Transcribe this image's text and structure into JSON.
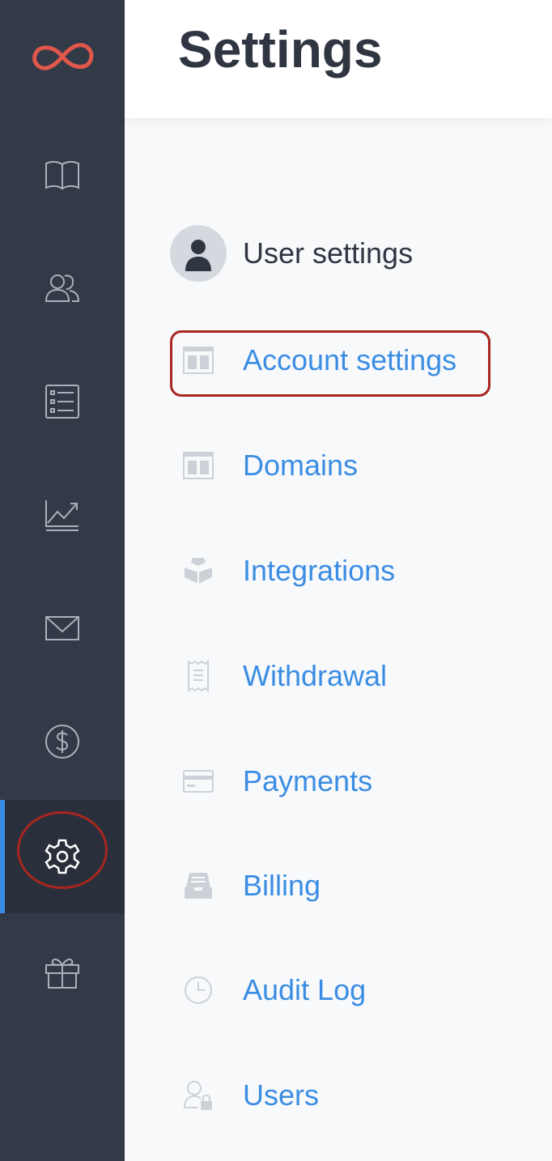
{
  "header": {
    "title": "Settings"
  },
  "sidebar": {
    "items": [
      {
        "icon": "book-icon"
      },
      {
        "icon": "users-icon"
      },
      {
        "icon": "list-icon"
      },
      {
        "icon": "chart-icon"
      },
      {
        "icon": "mail-icon"
      },
      {
        "icon": "dollar-icon"
      },
      {
        "icon": "gear-icon",
        "active": true
      },
      {
        "icon": "gift-icon"
      }
    ]
  },
  "menu": {
    "items": [
      {
        "label": "User settings",
        "icon": "user-avatar-icon"
      },
      {
        "label": "Account settings",
        "icon": "layout-icon",
        "highlighted": true
      },
      {
        "label": "Domains",
        "icon": "layout-icon"
      },
      {
        "label": "Integrations",
        "icon": "cubes-icon"
      },
      {
        "label": "Withdrawal",
        "icon": "receipt-icon"
      },
      {
        "label": "Payments",
        "icon": "credit-card-icon"
      },
      {
        "label": "Billing",
        "icon": "inbox-tray-icon"
      },
      {
        "label": "Audit Log",
        "icon": "clock-icon"
      },
      {
        "label": "Users",
        "icon": "user-lock-icon"
      }
    ]
  },
  "colors": {
    "sidebar": "#333a47",
    "accent": "#3b8de3",
    "logo": "#e2574c",
    "annotation": "#a8261f"
  }
}
